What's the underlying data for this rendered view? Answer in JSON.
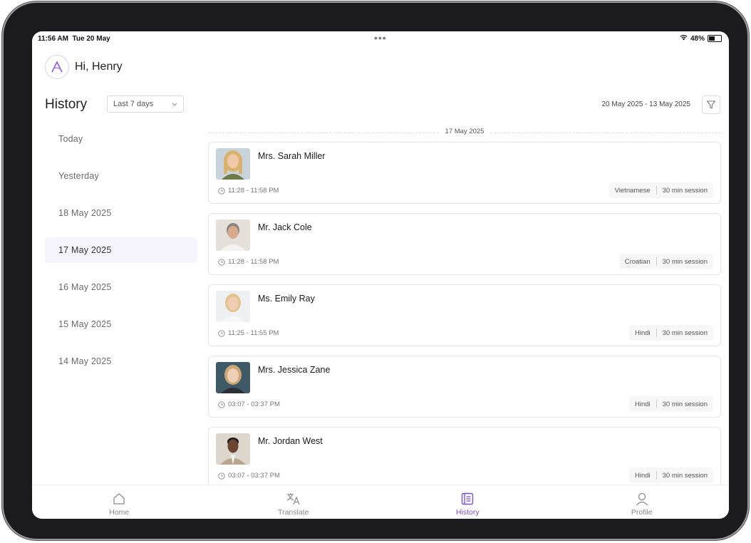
{
  "status_bar": {
    "time": "11:56 AM",
    "date": "Tue 20 May",
    "dots": "•••",
    "battery": "48%"
  },
  "header": {
    "greeting": "Hi, Henry",
    "logo_icon": "app-logo-icon"
  },
  "history": {
    "title": "History",
    "range_select": "Last 7 days",
    "date_range": "20 May 2025 - 13 May 2025",
    "filter_icon": "filter-icon"
  },
  "sidebar": {
    "items": [
      {
        "label": "Today"
      },
      {
        "label": "Yesterday"
      },
      {
        "label": "18 May 2025"
      },
      {
        "label": "17 May 2025",
        "active": true
      },
      {
        "label": "16 May 2025"
      },
      {
        "label": "15 May 2025"
      },
      {
        "label": "14 May 2025"
      }
    ]
  },
  "sessions": {
    "date_heading": "17 May 2025",
    "items": [
      {
        "name": "Mrs. Sarah Miller",
        "time": "11:28 - 11:58 PM",
        "language": "Vietnamese",
        "duration": "30 min session"
      },
      {
        "name": "Mr. Jack Cole",
        "time": "11:28 - 11:58 PM",
        "language": "Croatian",
        "duration": "30 min session"
      },
      {
        "name": "Ms. Emily Ray",
        "time": "11:25 - 11:55 PM",
        "language": "Hindi",
        "duration": "30 min session"
      },
      {
        "name": "Mrs. Jessica Zane",
        "time": "03:07 - 03:37 PM",
        "language": "Hindi",
        "duration": "30 min session"
      },
      {
        "name": "Mr. Jordan West",
        "time": "03:07 - 03:37 PM",
        "language": "Hindi",
        "duration": "30 min session"
      }
    ]
  },
  "tabbar": {
    "home": "Home",
    "translate": "Translate",
    "history": "History",
    "profile": "Profile"
  },
  "colors": {
    "accent": "#7a4fc9",
    "active_bg": "#f6f4fc"
  }
}
